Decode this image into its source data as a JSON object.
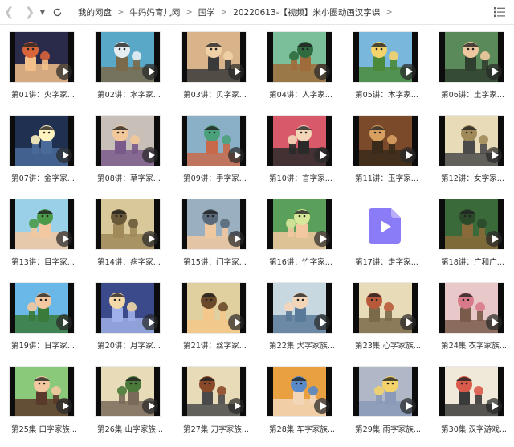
{
  "toolbar": {
    "icons": [
      "back-icon",
      "forward-icon",
      "dropdown-icon",
      "refresh-icon",
      "list-view-icon"
    ],
    "breadcrumbs": [
      "我的网盘",
      "牛妈妈育儿网",
      "国学",
      "20220613-【视频】米小圈动画汉字课"
    ]
  },
  "files": [
    {
      "name": "第01讲：火字家...",
      "bg": "#2a2a4a",
      "c1": "#d8643a",
      "c2": "#f3c08a"
    },
    {
      "name": "第02讲：水字家...",
      "bg": "#5aa8c8",
      "c1": "#e6eef2",
      "c2": "#7a6a4a"
    },
    {
      "name": "第03讲：贝字家...",
      "bg": "#d9b48a",
      "c1": "#f1d2a8",
      "c2": "#3a3a3a"
    },
    {
      "name": "第04讲：人字家...",
      "bg": "#7bbf9a",
      "c1": "#2f6b3f",
      "c2": "#a06b3a"
    },
    {
      "name": "第05讲：木字家...",
      "bg": "#79b8dc",
      "c1": "#f3d36a",
      "c2": "#4a8a3a"
    },
    {
      "name": "第06讲：土字家...",
      "bg": "#5a8a5a",
      "c1": "#f0c8a0",
      "c2": "#2f3f2f"
    },
    {
      "name": "第07讲：金字家...",
      "bg": "#1f3050",
      "c1": "#fff4c0",
      "c2": "#4a6a9a"
    },
    {
      "name": "第08讲：草字家...",
      "bg": "#c8c0b8",
      "c1": "#f3c89a",
      "c2": "#7a5a8a"
    },
    {
      "name": "第09讲：手字家...",
      "bg": "#8ab0c8",
      "c1": "#4aa07a",
      "c2": "#c86a4a"
    },
    {
      "name": "第10讲：言字家...",
      "bg": "#d85a6a",
      "c1": "#f3d6b8",
      "c2": "#2a2a2a"
    },
    {
      "name": "第11讲：玉字家...",
      "bg": "#7a4a2a",
      "c1": "#d8a060",
      "c2": "#3a2a1a"
    },
    {
      "name": "第12讲：女字家...",
      "bg": "#e8dcb8",
      "c1": "#a08a5a",
      "c2": "#4a4a4a"
    },
    {
      "name": "第13讲：目字家...",
      "bg": "#9ad0e8",
      "c1": "#4a9a4a",
      "c2": "#f3c8a0"
    },
    {
      "name": "第14讲：病字家...",
      "bg": "#d8c89a",
      "c1": "#6a5a3a",
      "c2": "#a08a5a"
    },
    {
      "name": "第15讲：门字家...",
      "bg": "#9ab0c0",
      "c1": "#5a6a7a",
      "c2": "#f0c8a0"
    },
    {
      "name": "第16讲：竹字家...",
      "bg": "#5aa05a",
      "c1": "#d8e89a",
      "c2": "#f3c8a0"
    },
    {
      "name": "第17讲：走字家...",
      "bg": "",
      "c1": "",
      "c2": ""
    },
    {
      "name": "第18讲：广和广...",
      "bg": "#3a6a3a",
      "c1": "#2a4a2a",
      "c2": "#8a6a3a"
    },
    {
      "name": "第19讲：日字家...",
      "bg": "#6ab8e8",
      "c1": "#f3c8a0",
      "c2": "#3a7a3a"
    },
    {
      "name": "第20讲：月字家...",
      "bg": "#3a4a8a",
      "c1": "#f3d8a8",
      "c2": "#a0b0e8"
    },
    {
      "name": "第21讲：丝字家...",
      "bg": "#e0d0a0",
      "c1": "#6a4a2a",
      "c2": "#f3c88a"
    },
    {
      "name": "第22集 犬字家族...",
      "bg": "#c8d8e0",
      "c1": "#f3d6b8",
      "c2": "#5a7a9a"
    },
    {
      "name": "第23集 心字家族...",
      "bg": "#e8dcb8",
      "c1": "#b85a3a",
      "c2": "#7a6a4a"
    },
    {
      "name": "第24集 衣字家族...",
      "bg": "#e8c8c8",
      "c1": "#d87a8a",
      "c2": "#7a5a4a"
    },
    {
      "name": "第25集 口字家族...",
      "bg": "#8ac87a",
      "c1": "#f3c8a0",
      "c2": "#5a3a2a"
    },
    {
      "name": "第26集 山字家族...",
      "bg": "#e8dcb8",
      "c1": "#4a7a3a",
      "c2": "#7a6a5a"
    },
    {
      "name": "第27集 刀字家族...",
      "bg": "#e8dcb8",
      "c1": "#8a4a2a",
      "c2": "#4a4a4a"
    },
    {
      "name": "第28集 车字家族...",
      "bg": "#e8a040",
      "c1": "#5a8ac8",
      "c2": "#f3d6b8"
    },
    {
      "name": "第29集 雨字家族...",
      "bg": "#b0b8c8",
      "c1": "#f3d36a",
      "c2": "#8a9ab8"
    },
    {
      "name": "第30集 汉字游戏...",
      "bg": "#f0e8d8",
      "c1": "#d85a4a",
      "c2": "#3a3a3a"
    }
  ]
}
